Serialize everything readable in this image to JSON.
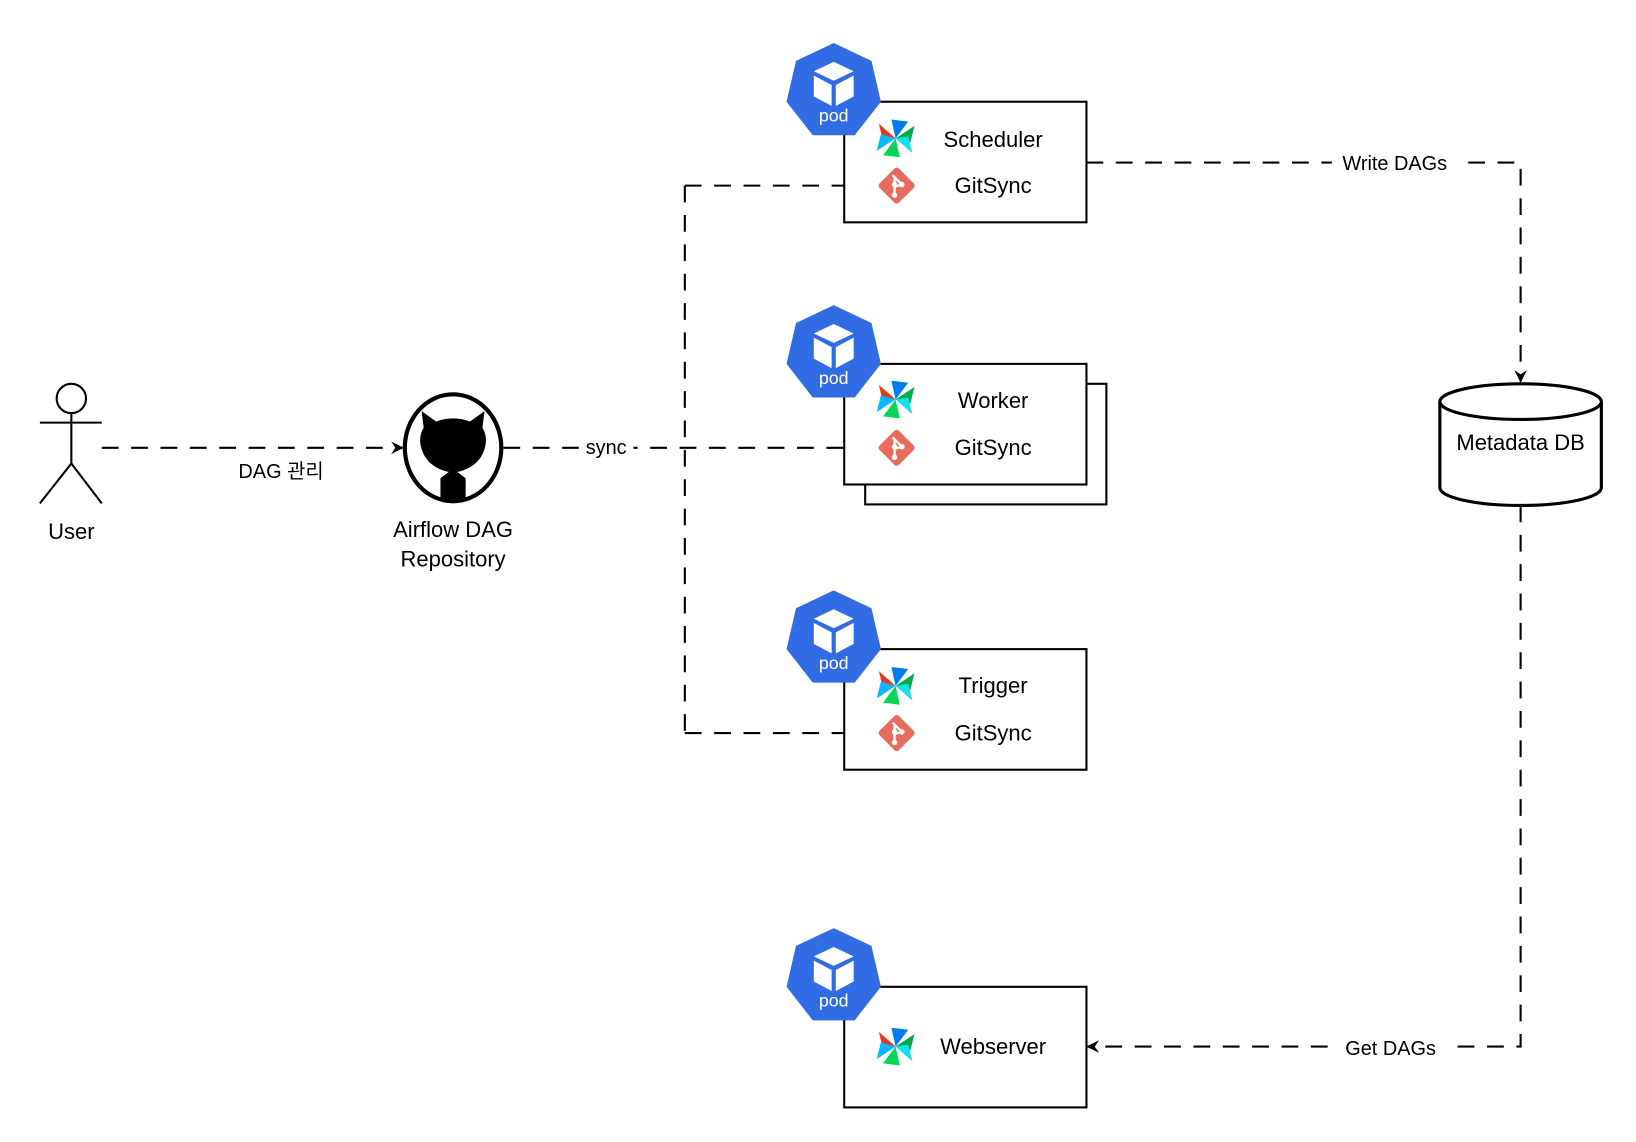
{
  "actors": {
    "user": "User"
  },
  "repository": {
    "label_line1": "Airflow DAG",
    "label_line2": "Repository",
    "icon": "github-icon"
  },
  "edges": {
    "user_to_repo": "DAG 관리",
    "repo_sync": "sync",
    "write": "Write DAGs",
    "get": "Get DAGs"
  },
  "pods": [
    {
      "badge": "pod",
      "component": "Scheduler",
      "sidecar": "GitSync"
    },
    {
      "badge": "pod",
      "component": "Worker",
      "sidecar": "GitSync"
    },
    {
      "badge": "pod",
      "component": "Trigger",
      "sidecar": "GitSync"
    },
    {
      "badge": "pod",
      "component": "Webserver"
    }
  ],
  "database": {
    "label": "Metadata DB"
  },
  "colors": {
    "pod": "#326CE5",
    "git": "#E96B5D"
  }
}
